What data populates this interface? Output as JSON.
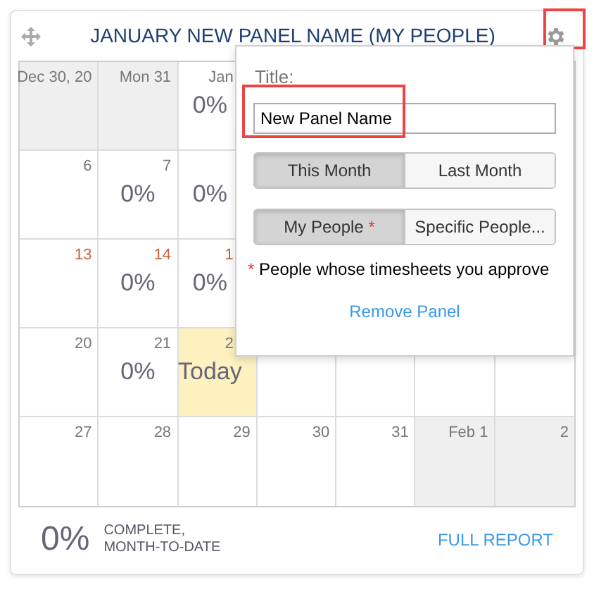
{
  "panel": {
    "title": "JANUARY NEW PANEL NAME (MY PEOPLE)",
    "settings_annotated": true
  },
  "calendar": {
    "rows": [
      {
        "cells": [
          {
            "date": "Dec 30, 20",
            "out_of_month": true
          },
          {
            "date": "Mon 31",
            "out_of_month": true
          },
          {
            "date": "Jan",
            "percent": "0%",
            "kind": "partly_covered"
          },
          {
            "kind": "covered"
          },
          {
            "kind": "covered"
          },
          {
            "kind": "covered"
          },
          {
            "kind": "covered"
          }
        ]
      },
      {
        "cells": [
          {
            "date": "6"
          },
          {
            "date": "7",
            "percent": "0%"
          },
          {
            "percent": "0%",
            "kind": "partly_covered"
          },
          {
            "kind": "covered"
          },
          {
            "kind": "covered"
          },
          {
            "kind": "covered"
          },
          {
            "kind": "covered"
          }
        ]
      },
      {
        "cells": [
          {
            "date": "13",
            "past_due": true
          },
          {
            "date": "14",
            "past_due": true,
            "percent": "0%"
          },
          {
            "date": "1",
            "past_due": true,
            "percent": "0%",
            "kind": "partly_covered"
          },
          {
            "kind": "covered"
          },
          {
            "kind": "covered"
          },
          {
            "kind": "covered"
          },
          {
            "kind": "covered"
          }
        ]
      },
      {
        "cells": [
          {
            "date": "20"
          },
          {
            "date": "21",
            "percent": "0%"
          },
          {
            "date": "2",
            "today_label": "Today",
            "today": true,
            "kind": "partly_covered"
          },
          {
            "kind": "partly_covered"
          },
          {
            "kind": "partly_covered"
          },
          {
            "kind": "partly_covered"
          },
          {
            "kind": "partly_covered"
          }
        ]
      },
      {
        "cells": [
          {
            "date": "27"
          },
          {
            "date": "28"
          },
          {
            "date": "29"
          },
          {
            "date": "30"
          },
          {
            "date": "31"
          },
          {
            "date": "Feb 1",
            "out_of_month": true
          },
          {
            "date": "2",
            "out_of_month": true
          }
        ]
      }
    ]
  },
  "popup": {
    "title_label": "Title:",
    "title_value": "New Panel Name",
    "title_annotated": true,
    "period_options": [
      {
        "label": "This Month",
        "selected": true
      },
      {
        "label": "Last Month",
        "selected": false
      }
    ],
    "people_options": [
      {
        "label": "My People",
        "marker": "*",
        "selected": true
      },
      {
        "label": "Specific People...",
        "selected": false
      }
    ],
    "note_marker": "*",
    "note": "People whose timesheets you approve",
    "remove_link": "Remove Panel"
  },
  "footer": {
    "percent": "0%",
    "caption_line_1": "COMPLETE,",
    "caption_line_2": "MONTH-TO-DATE",
    "report_link": "FULL REPORT"
  }
}
